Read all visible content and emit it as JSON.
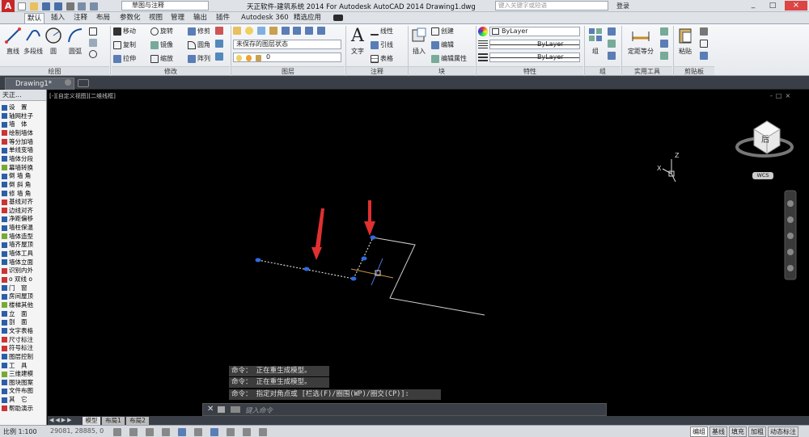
{
  "titlebar": {
    "app_menu": "A",
    "workspace": "草图与注释",
    "title": "天正软件-建筑系统 2014  For Autodesk AutoCAD 2014    Drawing1.dwg",
    "search_placeholder": "键入关键字或短语",
    "login": "登录"
  },
  "tabs": [
    "默认",
    "插入",
    "注释",
    "布局",
    "参数化",
    "视图",
    "管理",
    "输出",
    "插件",
    "Autodesk 360",
    "精选应用"
  ],
  "ribbon": {
    "draw": {
      "line": "直线",
      "polyline": "多段线",
      "circle": "圆",
      "arc": "圆弧",
      "title": "绘图"
    },
    "modify": {
      "move": "移动",
      "rotate": "旋转",
      "trim": "修剪",
      "copy": "复制",
      "mirror": "镜像",
      "fillet": "圆角",
      "stretch": "拉伸",
      "scale": "缩放",
      "array": "阵列",
      "title": "修改"
    },
    "layers": {
      "state": "未保存的图层状态",
      "layer": "0",
      "title": "图层"
    },
    "annotation": {
      "text": "文字",
      "linear": "线性",
      "leader": "引线",
      "table": "表格",
      "title": "注释"
    },
    "block": {
      "insert": "插入",
      "create": "创建",
      "edit": "编辑",
      "edit_attr": "编辑属性",
      "title": "块"
    },
    "properties": {
      "color": "ByLayer",
      "linetype": "ByLayer",
      "lineweight": "ByLayer",
      "title": "特性"
    },
    "groups": {
      "group": "组",
      "title": "组"
    },
    "utilities": {
      "measure": "定距等分",
      "title": "实用工具"
    },
    "clipboard": {
      "paste": "粘贴",
      "title": "剪贴板"
    }
  },
  "doc_tab": "Drawing1*",
  "sidebar": {
    "title": "天正...",
    "items": [
      "设　置",
      "轴网柱子",
      "墙　体",
      "绘制墙体",
      "等分加墙",
      "单线变墙",
      "墙体分段",
      "幕墙转换",
      "倒 墙 角",
      "倒 斜 角",
      "修 墙 角",
      "基线对齐",
      "边线对齐",
      "净距偏移",
      "墙柱保温",
      "墙体造型",
      "墙齐屋顶",
      "墙体工具",
      "墙体立面",
      "识别内外",
      "o 双线 o",
      "门　窗",
      "房间屋顶",
      "楼梯其他",
      "立　面",
      "剖　面",
      "文字表格",
      "尺寸标注",
      "符号标注",
      "图层控制",
      "工　具",
      "三维建模",
      "图块图案",
      "文件布图",
      "其　它",
      "帮助演示"
    ]
  },
  "viewport_label": "[-][自定义视图][二维线框]",
  "viewcube": {
    "face": "后",
    "wcs": "WCS"
  },
  "ucs": {
    "z": "Z",
    "x": "X"
  },
  "command": {
    "history": [
      "命令：  正在重生成模型。",
      "命令：  正在重生成模型。",
      "命令： 指定对角点或 [栏选(F)/圈围(WP)/圈交(CP)]:"
    ],
    "placeholder": "键入命令"
  },
  "layout_tabs": [
    "模型",
    "布局1",
    "布局2"
  ],
  "status": {
    "scale": "比例 1:100",
    "coords": "29081, 28885, 0",
    "buttons": [
      "编组",
      "基线",
      "填充",
      "加粗",
      "动态标注"
    ],
    "ime": "中"
  },
  "colors": {
    "accent_red": "#e03030",
    "grip_blue": "#2f6be0",
    "ribbon_bg": "#eef0f3"
  }
}
